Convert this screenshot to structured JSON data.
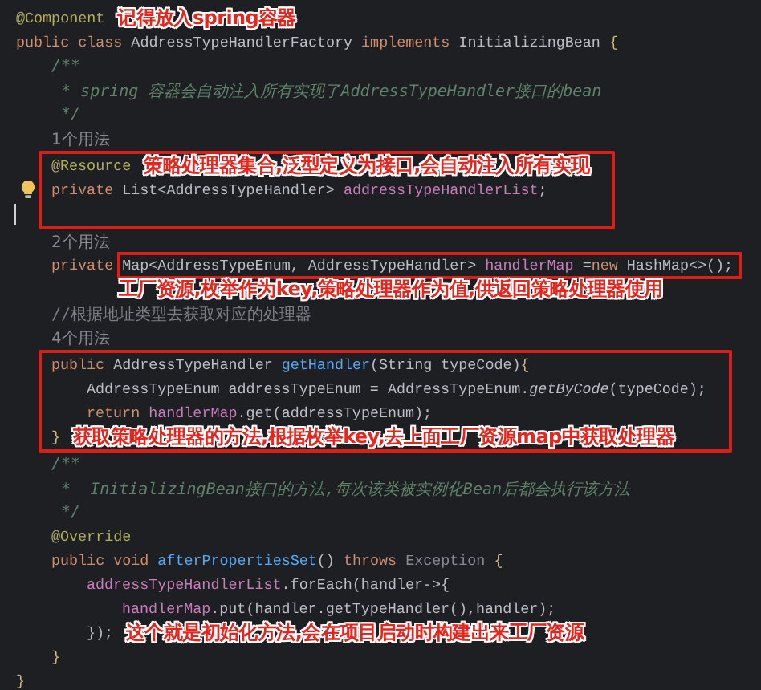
{
  "editor": {
    "lines": [
      {
        "kind": "line",
        "tokens": [
          {
            "text": "@Component",
            "kind": "annotation"
          }
        ],
        "note": "记得放入spring容器"
      },
      {
        "kind": "line",
        "tokens": [
          {
            "text": "public class",
            "kind": "keyword"
          },
          {
            "text": " AddressTypeHandlerFactory ",
            "kind": "plain"
          },
          {
            "text": "implements",
            "kind": "keyword"
          },
          {
            "text": " InitializingBean ",
            "kind": "plain"
          },
          {
            "text": "{",
            "kind": "brace"
          }
        ],
        "children": [
          {
            "kind": "line",
            "tokens": [
              {
                "text": "/**",
                "kind": "doc"
              }
            ]
          },
          {
            "kind": "line",
            "tokens": [
              {
                "text": " * spring 容器会自动注入所有实现了AddressTypeHandler接口的bean",
                "kind": "doc"
              }
            ]
          },
          {
            "kind": "line",
            "tokens": [
              {
                "text": " */",
                "kind": "doc"
              }
            ]
          },
          {
            "kind": "hint",
            "text": "1个用法"
          },
          {
            "kind": "frame",
            "lines": [
              {
                "kind": "line",
                "tokens": [
                  {
                    "text": "@Resource",
                    "kind": "annotation"
                  }
                ],
                "note": "策略处理器集合,泛型定义为接口,会自动注入所有实现"
              },
              {
                "kind": "line",
                "bulb": true,
                "tokens": [
                  {
                    "text": "private",
                    "kind": "keyword"
                  },
                  {
                    "text": " List<AddressTypeHandler> ",
                    "kind": "plain"
                  },
                  {
                    "text": "addressTypeHandlerList",
                    "kind": "field"
                  },
                  {
                    "text": ";",
                    "kind": "plain"
                  }
                ]
              },
              {
                "kind": "blank",
                "cursor": true
              }
            ]
          },
          {
            "kind": "hint",
            "text": "2个用法"
          },
          {
            "kind": "line",
            "tokens": [
              {
                "text": "private ",
                "kind": "keyword"
              },
              {
                "kind": "frame",
                "tokens": [
                  {
                    "text": "Map<AddressTypeEnum, AddressTypeHandler> ",
                    "kind": "plain"
                  },
                  {
                    "text": "handlerMap",
                    "kind": "field"
                  },
                  {
                    "text": " =",
                    "kind": "plain"
                  },
                  {
                    "text": "new",
                    "kind": "keyword"
                  },
                  {
                    "text": " HashMap<>();",
                    "kind": "plain"
                  }
                ]
              }
            ]
          },
          {
            "kind": "note",
            "text": "工厂资源,枚举作为key,策略处理器作为值,供返回策略处理器使用"
          },
          {
            "kind": "line",
            "tokens": [
              {
                "text": "//根据地址类型去获取对应的处理器",
                "kind": "comment"
              }
            ]
          },
          {
            "kind": "hint",
            "text": "4个用法"
          },
          {
            "kind": "frame",
            "lines": [
              {
                "kind": "line",
                "tokens": [
                  {
                    "text": "public",
                    "kind": "keyword"
                  },
                  {
                    "text": " AddressTypeHandler ",
                    "kind": "plain"
                  },
                  {
                    "text": "getHandler",
                    "kind": "method"
                  },
                  {
                    "text": "(String typeCode)",
                    "kind": "plain"
                  },
                  {
                    "text": "{",
                    "kind": "brace"
                  }
                ],
                "children": [
                  {
                    "kind": "line",
                    "tokens": [
                      {
                        "text": "AddressTypeEnum addressTypeEnum = AddressTypeEnum.",
                        "kind": "plain"
                      },
                      {
                        "text": "getByCode",
                        "kind": "static"
                      },
                      {
                        "text": "(typeCode);",
                        "kind": "plain"
                      }
                    ]
                  },
                  {
                    "kind": "line",
                    "tokens": [
                      {
                        "text": "return ",
                        "kind": "keyword"
                      },
                      {
                        "text": "handlerMap",
                        "kind": "field"
                      },
                      {
                        "text": ".get(addressTypeEnum);",
                        "kind": "plain"
                      }
                    ]
                  }
                ]
              },
              {
                "kind": "line",
                "tokens": [
                  {
                    "text": "}",
                    "kind": "brace"
                  }
                ],
                "note": "获取策略处理器的方法,根据枚举key,去上面工厂资源map中获取处理器"
              }
            ]
          },
          {
            "kind": "line",
            "tokens": [
              {
                "text": "/**",
                "kind": "doc"
              }
            ]
          },
          {
            "kind": "line",
            "tokens": [
              {
                "text": " *  InitializingBean接口的方法,每次该类被实例化Bean后都会执行该方法",
                "kind": "doc"
              }
            ]
          },
          {
            "kind": "line",
            "tokens": [
              {
                "text": " */",
                "kind": "doc"
              }
            ]
          },
          {
            "kind": "line",
            "tokens": [
              {
                "text": "@Override",
                "kind": "annotation"
              }
            ]
          },
          {
            "kind": "line",
            "tokens": [
              {
                "text": "public void ",
                "kind": "keyword"
              },
              {
                "text": "afterPropertiesSet",
                "kind": "method"
              },
              {
                "text": "() ",
                "kind": "plain"
              },
              {
                "text": "throws ",
                "kind": "keyword"
              },
              {
                "text": "Exception",
                "kind": "dim"
              },
              {
                "text": " {",
                "kind": "brace"
              }
            ],
            "children": [
              {
                "kind": "line",
                "tokens": [
                  {
                    "text": "addressTypeHandlerList",
                    "kind": "field"
                  },
                  {
                    "text": ".forEach(handler->{",
                    "kind": "plain"
                  }
                ],
                "children": [
                  {
                    "kind": "line",
                    "tokens": [
                      {
                        "text": "handlerMap",
                        "kind": "field"
                      },
                      {
                        "text": ".put(handler.getTypeHandler(),handler);",
                        "kind": "plain"
                      }
                    ]
                  }
                ]
              },
              {
                "kind": "line",
                "tokens": [
                  {
                    "text": "});",
                    "kind": "plain"
                  }
                ],
                "note": "这个就是初始化方法,会在项目启动时构建出来工厂资源"
              }
            ]
          },
          {
            "kind": "line",
            "tokens": [
              {
                "text": "}",
                "kind": "brace"
              }
            ]
          }
        ]
      },
      {
        "kind": "line",
        "tokens": [
          {
            "text": "}",
            "kind": "brace"
          }
        ]
      }
    ]
  }
}
